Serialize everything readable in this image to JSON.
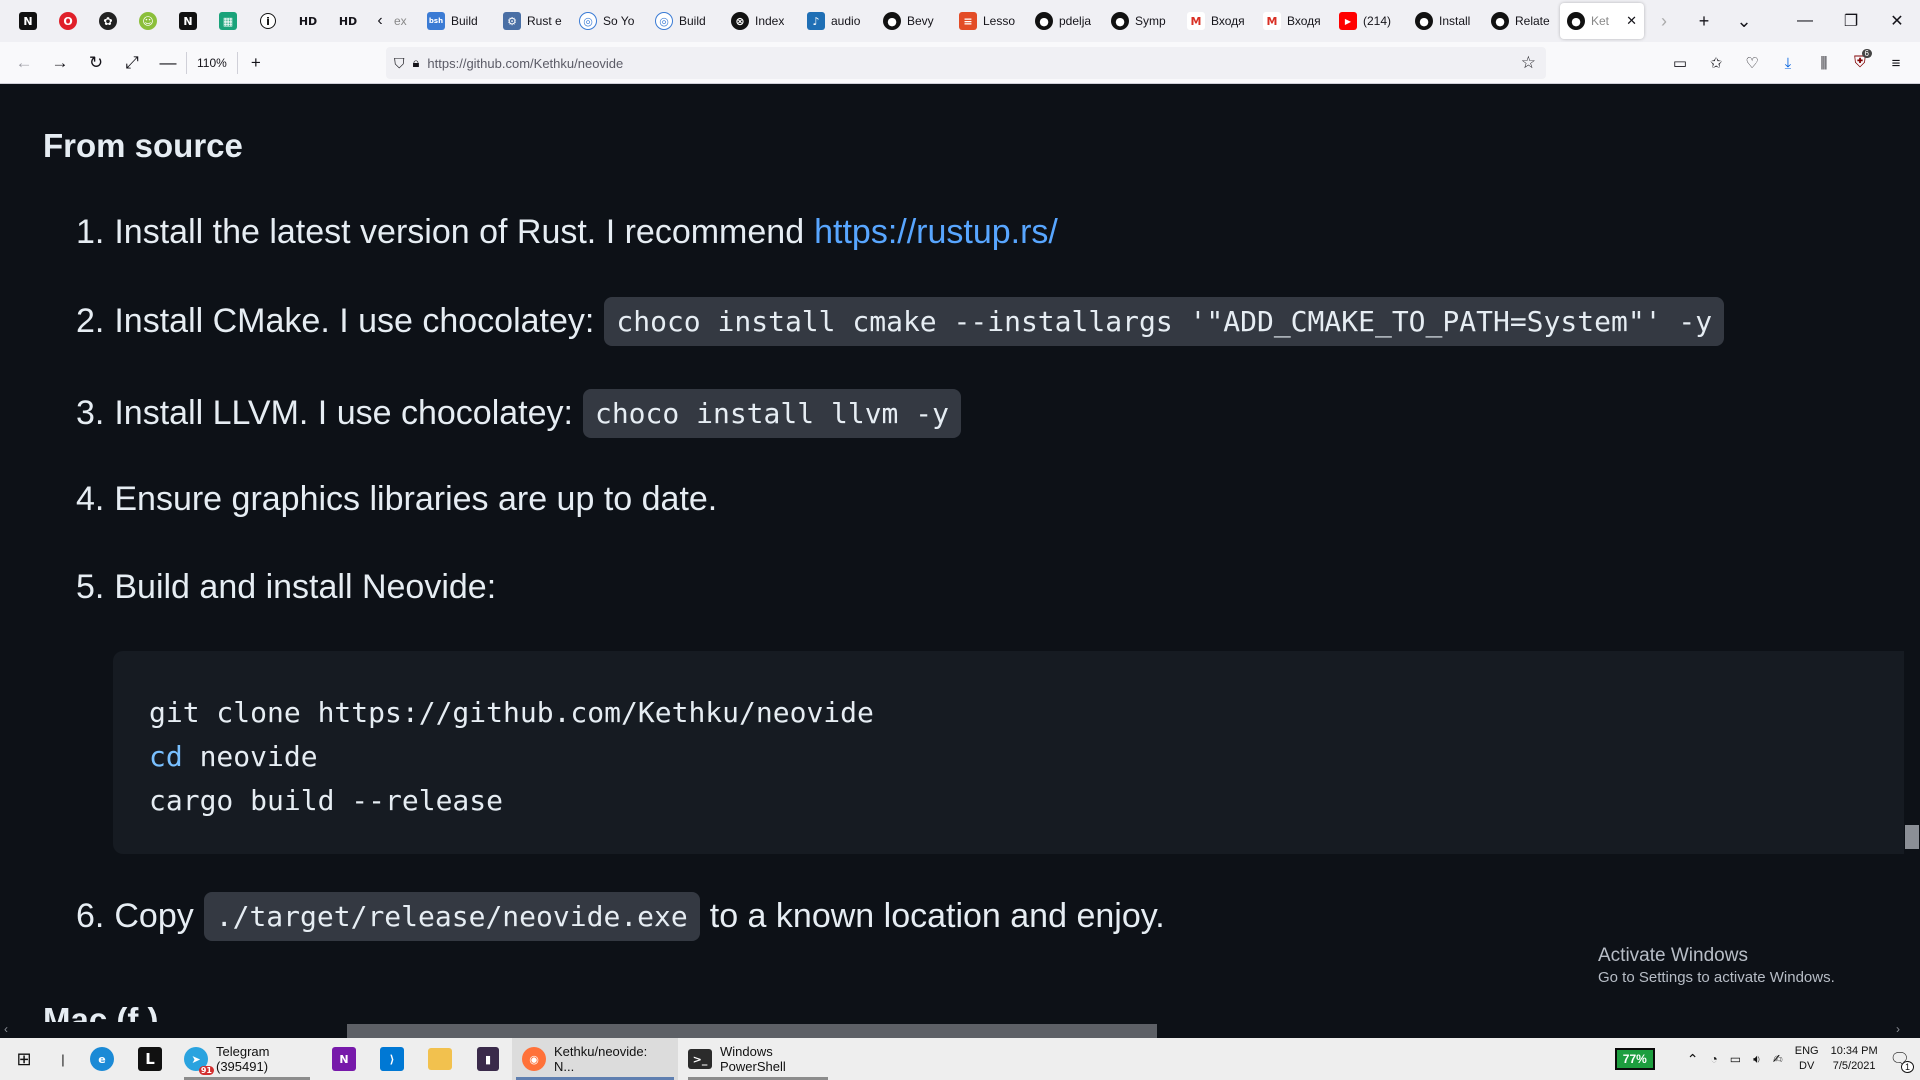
{
  "browser": {
    "pinned_tabs": [
      {
        "icon": "notion-icon",
        "label": ""
      },
      {
        "icon": "opera-icon",
        "label": ""
      },
      {
        "icon": "chatgpt-icon",
        "label": ""
      },
      {
        "icon": "kiwi-icon",
        "label": ""
      },
      {
        "icon": "notion-icon",
        "label": ""
      },
      {
        "icon": "tiles-icon",
        "label": ""
      },
      {
        "icon": "info-icon",
        "label": ""
      },
      {
        "icon": "hd-icon",
        "label": "HD"
      },
      {
        "icon": "hd-icon",
        "label": "HD"
      }
    ],
    "tabs": [
      {
        "icon": "page-icon",
        "label": "ex"
      },
      {
        "icon": "bevy-book-icon",
        "label": "Build"
      },
      {
        "icon": "rust-icon",
        "label": "Rust e"
      },
      {
        "icon": "globe-icon",
        "label": "So Yo"
      },
      {
        "icon": "globe-icon",
        "label": "Build"
      },
      {
        "icon": "index-icon",
        "label": "Index"
      },
      {
        "icon": "audio-icon",
        "label": "audio"
      },
      {
        "icon": "github-icon",
        "label": "Bevy"
      },
      {
        "icon": "lesson-icon",
        "label": "Lesso"
      },
      {
        "icon": "github-icon",
        "label": "pdelja"
      },
      {
        "icon": "github-icon",
        "label": "Symp"
      },
      {
        "icon": "gmail-icon",
        "label": "Входя"
      },
      {
        "icon": "gmail-icon",
        "label": "Входя"
      },
      {
        "icon": "youtube-icon",
        "label": "(214)"
      },
      {
        "icon": "github-icon",
        "label": "Install"
      },
      {
        "icon": "github-icon",
        "label": "Relate"
      },
      {
        "icon": "github-icon",
        "label": "Ket",
        "active": true
      }
    ],
    "zoom": "110%",
    "url": "https://github.com/Kethku/neovide",
    "ublock_badge": "6"
  },
  "content": {
    "heading": "From source",
    "steps": [
      {
        "num": "1.",
        "text": "Install the latest version of Rust. I recommend",
        "link": "https://rustup.rs/"
      },
      {
        "num": "2.",
        "text": "Install CMake. I use chocolatey:",
        "code": "choco install cmake --installargs '\"ADD_CMAKE_TO_PATH=System\"' -y"
      },
      {
        "num": "3.",
        "text": "Install LLVM. I use chocolatey:",
        "code": "choco install llvm -y"
      },
      {
        "num": "4.",
        "text": "Ensure graphics libraries are up to date."
      },
      {
        "num": "5.",
        "text": "Build and install Neovide:"
      },
      {
        "num": "6.",
        "text": "Copy",
        "code": "./target/release/neovide.exe",
        "text_after": "to a known location and enjoy."
      }
    ],
    "code_block": {
      "line1": "git clone https://github.com/Kethku/neovide",
      "line2_kw": "cd",
      "line2_rest": " neovide",
      "line3": "cargo build --release"
    },
    "next_heading_partial": "Mac (f                    )"
  },
  "watermark": {
    "title": "Activate Windows",
    "subtitle": "Go to Settings to activate Windows."
  },
  "taskbar": {
    "telegram": "Telegram (395491)",
    "telegram_badge": "91",
    "firefox": "Kethku/neovide: N...",
    "powershell": "Windows PowerShell",
    "battery": "77%",
    "lang1": "ENG",
    "lang2": "DV",
    "time": "10:34 PM",
    "date": "7/5/2021",
    "notifications": "1"
  }
}
